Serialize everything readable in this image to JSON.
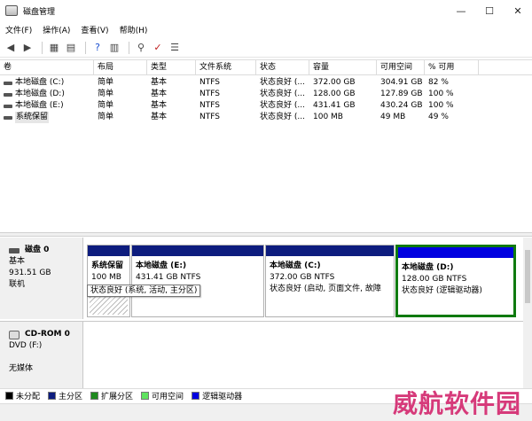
{
  "window": {
    "title": "磁盘管理",
    "minimize": "—",
    "maximize": "☐",
    "close": "✕"
  },
  "menu": [
    "文件(F)",
    "操作(A)",
    "查看(V)",
    "帮助(H)"
  ],
  "table": {
    "columns": [
      "卷",
      "布局",
      "类型",
      "文件系统",
      "状态",
      "容量",
      "可用空间",
      "% 可用"
    ],
    "rows": [
      [
        "本地磁盘 (C:)",
        "简单",
        "基本",
        "NTFS",
        "状态良好 (...",
        "372.00 GB",
        "304.91 GB",
        "82 %"
      ],
      [
        "本地磁盘 (D:)",
        "简单",
        "基本",
        "NTFS",
        "状态良好 (...",
        "128.00 GB",
        "127.89 GB",
        "100 %"
      ],
      [
        "本地磁盘 (E:)",
        "简单",
        "基本",
        "NTFS",
        "状态良好 (...",
        "431.41 GB",
        "430.24 GB",
        "100 %"
      ],
      [
        "系统保留",
        "简单",
        "基本",
        "NTFS",
        "状态良好 (...",
        "100 MB",
        "49 MB",
        "49 %"
      ]
    ]
  },
  "disk0": {
    "name": "磁盘 0",
    "type": "基本",
    "size": "931.51 GB",
    "status": "联机",
    "partitions": [
      {
        "name": "系统保留",
        "size": "100 MB",
        "status": ""
      },
      {
        "name": "本地磁盘  (E:)",
        "size": "431.41 GB NTFS",
        "status": ""
      },
      {
        "name": "本地磁盘  (C:)",
        "size": "372.00 GB NTFS",
        "status": "状态良好 (启动, 页面文件, 故障"
      },
      {
        "name": "本地磁盘  (D:)",
        "size": "128.00 GB NTFS",
        "status": "状态良好 (逻辑驱动器)"
      }
    ],
    "tooltip": "状态良好 (系统, 活动, 主分区)"
  },
  "cdrom": {
    "name": "CD-ROM 0",
    "type": "DVD (F:)",
    "status": "无媒体"
  },
  "legend": [
    {
      "label": "未分配",
      "color": "#000000"
    },
    {
      "label": "主分区",
      "color": "#0d1c7e"
    },
    {
      "label": "扩展分区",
      "color": "#1f8a1f"
    },
    {
      "label": "可用空间",
      "color": "#5fe35f"
    },
    {
      "label": "逻辑驱动器",
      "color": "#0000e0"
    }
  ],
  "watermark": "威航软件园"
}
